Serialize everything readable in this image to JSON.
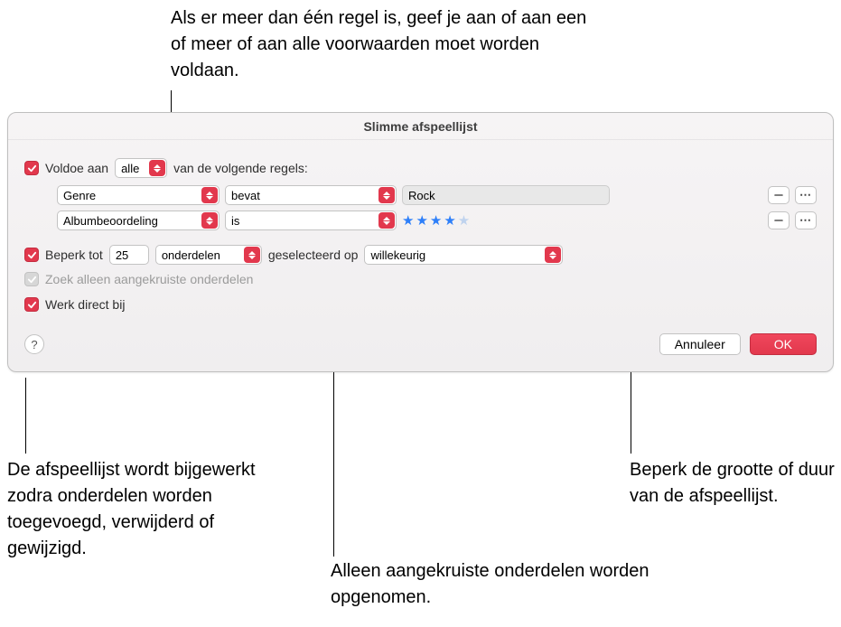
{
  "callouts": {
    "top": "Als er meer dan één regel is, geef je aan of aan een of meer of aan alle voorwaarden moet worden voldaan.",
    "bottomLeft": "De afspeellijst wordt bijgewerkt zodra onderdelen worden toegevoegd, verwijderd of gewijzigd.",
    "bottomMid": "Alleen aangekruiste onderdelen worden opgenomen.",
    "bottomRight": "Beperk de grootte of duur van de afspeellijst."
  },
  "window": {
    "title": "Slimme afspeellijst",
    "matchPrefix": "Voldoe aan",
    "matchSelect": "alle",
    "matchSuffix": "van de volgende regels:",
    "rules": [
      {
        "field": "Genre",
        "op": "bevat",
        "valueText": "Rock",
        "stars": 0
      },
      {
        "field": "Albumbeoordeling",
        "op": "is",
        "valueText": "",
        "stars": 4
      }
    ],
    "limitPrefix": "Beperk tot",
    "limitValue": "25",
    "limitUnit": "onderdelen",
    "limitSelectedBy": "geselecteerd op",
    "limitMethod": "willekeurig",
    "onlyCheckedLabel": "Zoek alleen aangekruiste onderdelen",
    "liveUpdateLabel": "Werk direct bij",
    "help": "?",
    "cancel": "Annuleer",
    "ok": "OK"
  }
}
